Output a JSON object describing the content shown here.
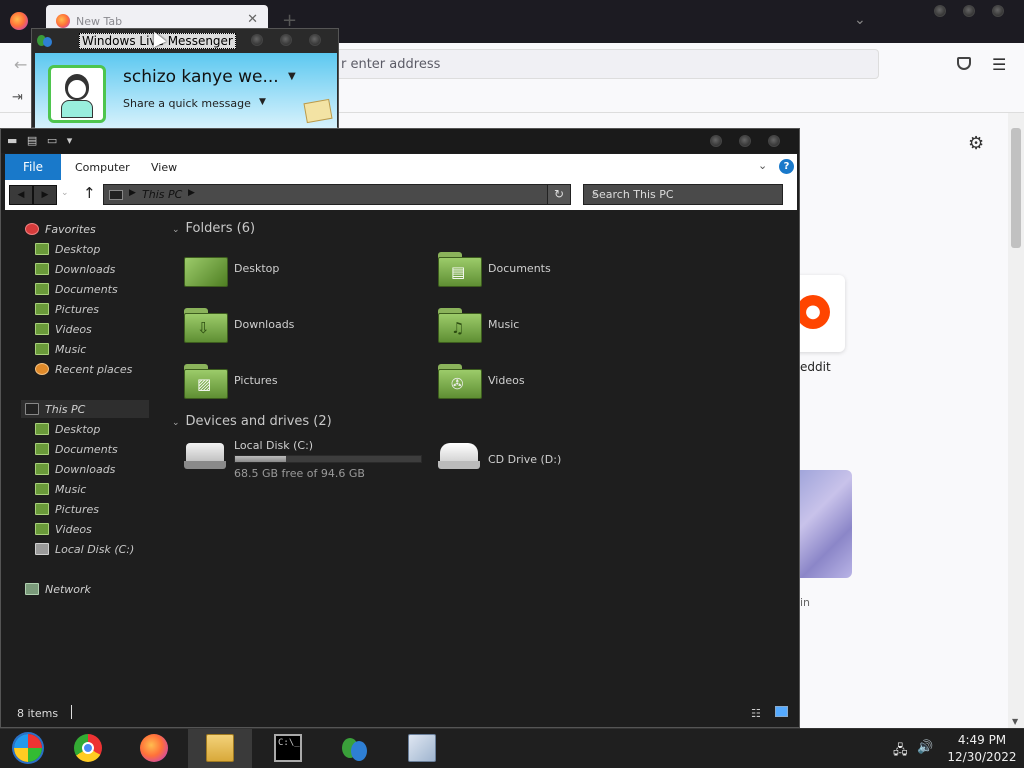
{
  "firefox": {
    "tab_title": "New Tab",
    "tab_close": "✕",
    "new_tab": "+",
    "url_placeholder": "r enter address",
    "shortcut_reddit_label": "eddit",
    "shortcut_image_label": "in",
    "accent": "#ff7139"
  },
  "messenger": {
    "window_title": "Windows Live Messenger",
    "display_name": "schizo kanye we...",
    "status_message": "Share a quick message",
    "header_color": "#5cc8f0"
  },
  "explorer": {
    "ribbon": {
      "file": "File",
      "tabs": [
        "Computer",
        "View"
      ],
      "help": "?"
    },
    "address": {
      "crumb": "This PC",
      "search_placeholder": "Search This PC"
    },
    "nav_pane": {
      "favorites_label": "Favorites",
      "favorites": [
        "Desktop",
        "Downloads",
        "Documents",
        "Pictures",
        "Videos",
        "Music",
        "Recent places"
      ],
      "this_pc_label": "This PC",
      "this_pc": [
        "Desktop",
        "Documents",
        "Downloads",
        "Music",
        "Pictures",
        "Videos",
        "Local Disk (C:)"
      ],
      "network_label": "Network"
    },
    "folders_group": "Folders (6)",
    "folders": [
      {
        "name": "Desktop",
        "icon": "desktop-folder-icon"
      },
      {
        "name": "Documents",
        "icon": "documents-folder-icon"
      },
      {
        "name": "Downloads",
        "icon": "downloads-folder-icon"
      },
      {
        "name": "Music",
        "icon": "music-folder-icon"
      },
      {
        "name": "Pictures",
        "icon": "pictures-folder-icon"
      },
      {
        "name": "Videos",
        "icon": "videos-folder-icon"
      }
    ],
    "devices_group": "Devices and drives (2)",
    "drives": [
      {
        "name": "Local Disk (C:)",
        "free": "68.5 GB free of 94.6 GB",
        "used_fraction": 0.276
      },
      {
        "name": "CD Drive (D:)"
      }
    ],
    "status": "8 items",
    "accent": "#1979ca"
  },
  "taskbar": {
    "time": "4:49 PM",
    "date": "12/30/2022"
  }
}
